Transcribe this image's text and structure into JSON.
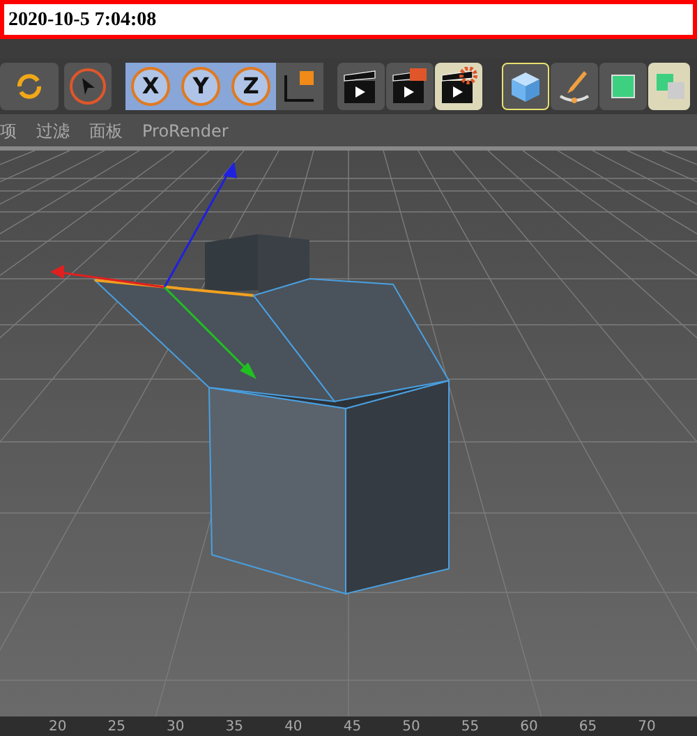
{
  "timestamp": "2020-10-5 7:04:08",
  "toolbar": {
    "axis_buttons": [
      {
        "label": "X",
        "selected": true
      },
      {
        "label": "Y",
        "selected": true
      },
      {
        "label": "Z",
        "selected": true
      }
    ]
  },
  "viewport_menu": [
    "项",
    "过滤",
    "面板",
    "ProRender"
  ],
  "timeline": {
    "ticks": [
      "20",
      "25",
      "30",
      "35",
      "40",
      "45",
      "50",
      "55",
      "60",
      "65",
      "70"
    ]
  }
}
